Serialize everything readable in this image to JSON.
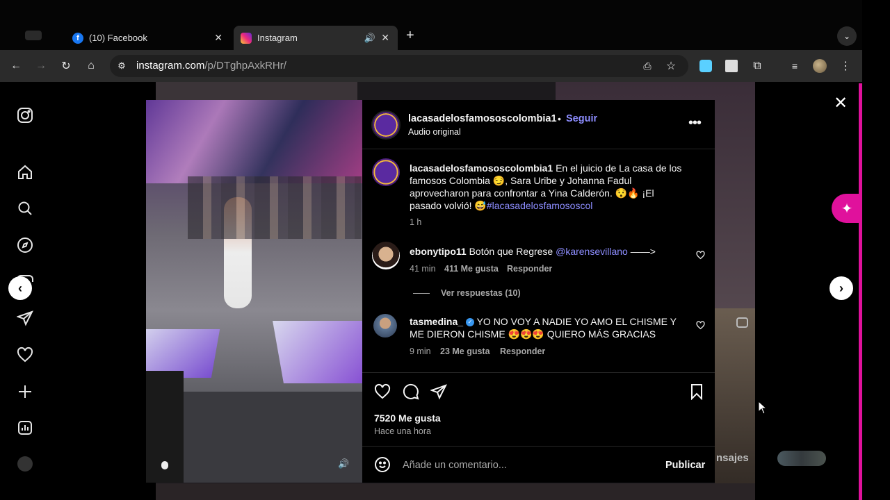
{
  "browser": {
    "tabs": [
      {
        "label": "(10) Facebook"
      },
      {
        "label": "Instagram"
      }
    ],
    "url_host": "instagram.com",
    "url_path": "/p/DTghpAxkRHr/"
  },
  "post": {
    "username": "lacasadelosfamososcolombia1",
    "separator": "•",
    "follow_label": "Seguir",
    "audio_label": "Audio original",
    "caption_user": "lacasadelosfamososcolombia1",
    "caption_line1": " En el juicio de La casa de los",
    "caption_line2": "famosos Colombia 😏, Sara Uribe y Johanna Fadul",
    "caption_line3": "aprovecharon para confrontar a Yina Calderón. 😯🔥 ¡El",
    "caption_line4_a": "pasado volvió! 😅",
    "caption_hashtag": "#lacasadelosfamososcol",
    "caption_time": "1 h",
    "comments": [
      {
        "user": "ebonytipo11",
        "text": " Botón que Regrese ",
        "mention": "@karensevillano",
        "text_end": " ——>",
        "time": "41 min",
        "likes": "411 Me gusta",
        "reply": "Responder"
      },
      {
        "user": "tasmedina_",
        "line1": " YO NO VOY A NADIE YO AMO EL CHISME Y",
        "line2": "ME DIERON CHISME 😍😍😍 QUIERO MÁS GRACIAS",
        "time": "9 min",
        "likes": "23 Me gusta",
        "reply": "Responder"
      }
    ],
    "view_replies": "Ver respuestas (10)",
    "likes_total": "7520 Me gusta",
    "posted_ago": "Hace una hora",
    "comment_placeholder": "Añade un comentario...",
    "publish_label": "Publicar"
  },
  "background": {
    "messages_label": "nsajes"
  },
  "colors": {
    "accent_link": "#8d8dff",
    "panel_bg": "#000000",
    "verified": "#3897f0",
    "side_accent": "#e0119c"
  }
}
